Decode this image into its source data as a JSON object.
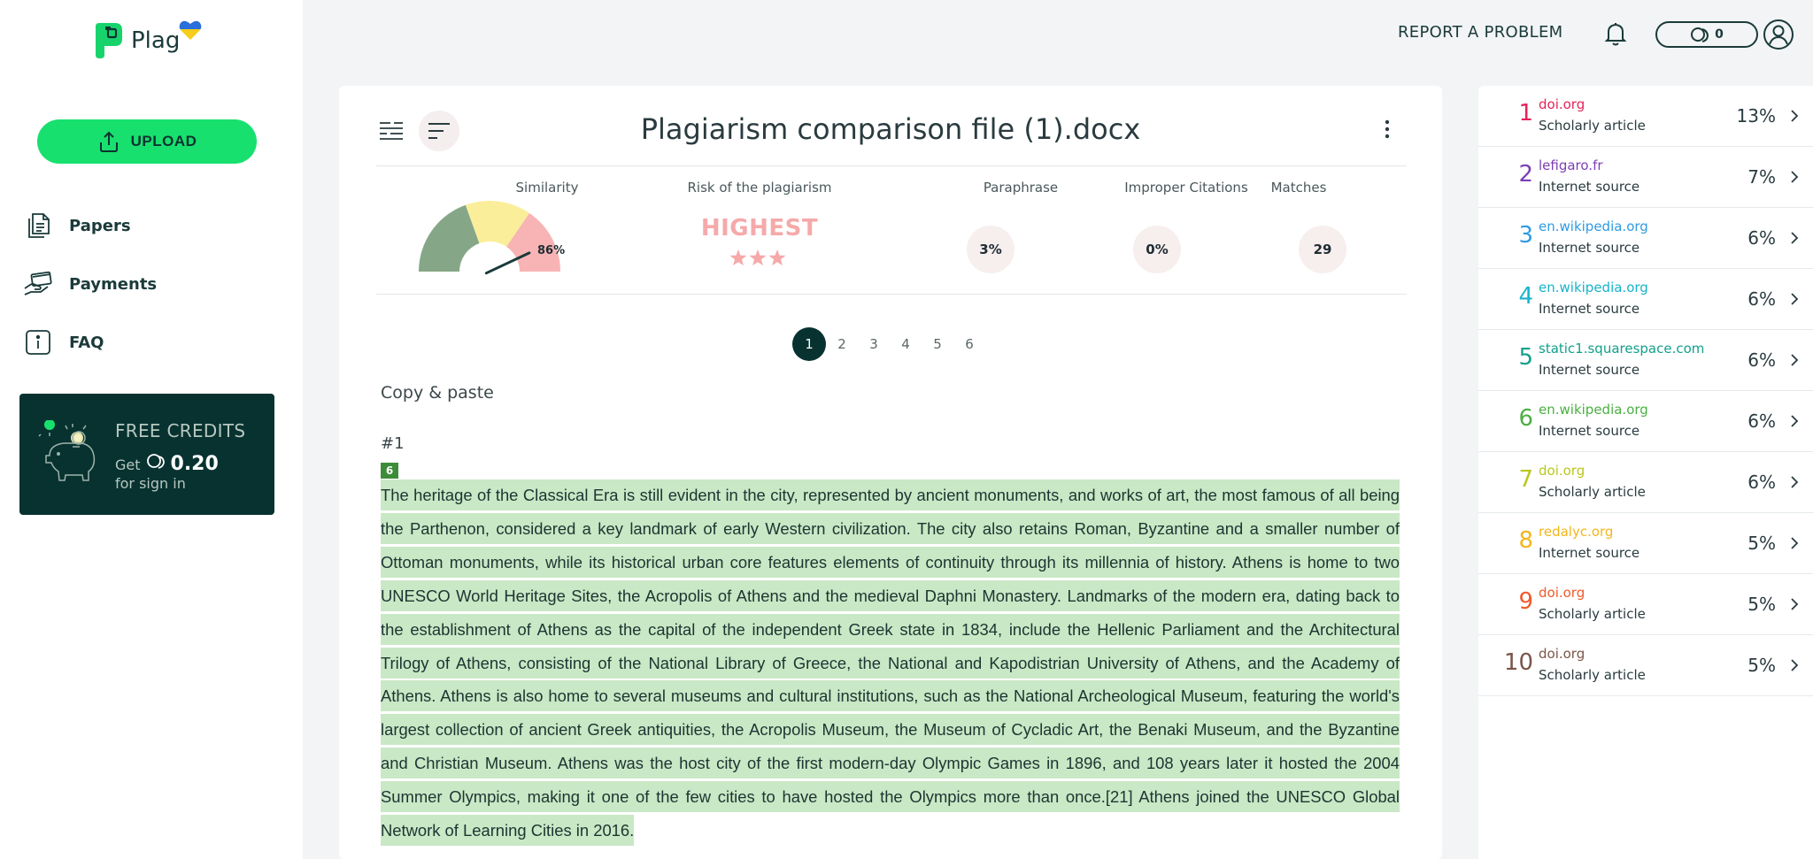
{
  "brand": {
    "name": "Plag",
    "logo_colors": {
      "green": "#18d36c",
      "heart_blue": "#2a6fdb",
      "heart_yellow": "#f6cd1a"
    }
  },
  "sidebar": {
    "upload_label": "UPLOAD",
    "nav": [
      {
        "label": "Papers",
        "icon": "document-icon"
      },
      {
        "label": "Payments",
        "icon": "hand-card-icon"
      },
      {
        "label": "FAQ",
        "icon": "info-icon"
      }
    ],
    "credits": {
      "title": "FREE CREDITS",
      "get": "Get",
      "amount": "0.20",
      "subtitle": "for sign in"
    }
  },
  "topbar": {
    "report": "REPORT A PROBLEM",
    "credit_count": "0"
  },
  "document": {
    "title": "Plagiarism comparison file (1).docx",
    "metrics": {
      "similarity_label": "Similarity",
      "similarity_value": "86%",
      "similarity_fraction": 0.86,
      "risk_label": "Risk of the plagiarism",
      "risk_value": "HIGHEST",
      "risk_stars": 3,
      "paraphrase_label": "Paraphrase",
      "paraphrase_value": "3%",
      "citations_label": "Improper Citations",
      "citations_value": "0%",
      "matches_label": "Matches",
      "matches_value": "29"
    },
    "pages": [
      "1",
      "2",
      "3",
      "4",
      "5",
      "6"
    ],
    "active_page": "1",
    "section_label": "Copy & paste",
    "paragraph_number": "#1",
    "match_badge": "6",
    "passage": "The heritage of the Classical Era is still evident in the city, represented by ancient monuments, and works of art, the most famous of all being the Parthenon, considered a key landmark of early Western civilization. The city also retains Roman, Byzantine and a smaller number of Ottoman monuments, while its historical urban core features elements of continuity through its millennia of history. Athens is home to two UNESCO World Heritage Sites, the Acropolis of Athens and the medieval Daphni Monastery. Landmarks of the modern era, dating back to the establishment of Athens as the capital of the independent Greek state in 1834, include the Hellenic Parliament and the Architectural Trilogy of Athens, consisting of the National Library of Greece, the National and Kapodistrian University of Athens, and the Academy of Athens. Athens is also home to several museums and cultural institutions, such as the National Archeological Museum, featuring the world's largest collection of ancient Greek antiquities, the Acropolis Museum, the Museum of Cycladic Art, the Benaki Museum, and the Byzantine and Christian Museum. Athens was the host city of the first modern-day Olympic Games in 1896, and 108 years later it hosted the 2004 Summer Olympics, making it one of the few cities to have hosted the Olympics more than once.[21] Athens joined the UNESCO Global Network of Learning Cities in 2016."
  },
  "sources": [
    {
      "rank": "1",
      "domain": "doi.org",
      "kind": "Scholarly article",
      "percent": "13%",
      "color": "#e3245a"
    },
    {
      "rank": "2",
      "domain": "lefigaro.fr",
      "kind": "Internet source",
      "percent": "7%",
      "color": "#7b3fb5"
    },
    {
      "rank": "3",
      "domain": "en.wikipedia.org",
      "kind": "Internet source",
      "percent": "6%",
      "color": "#2f9be0"
    },
    {
      "rank": "4",
      "domain": "en.wikipedia.org",
      "kind": "Internet source",
      "percent": "6%",
      "color": "#17b3c9"
    },
    {
      "rank": "5",
      "domain": "static1.squarespace.com",
      "kind": "Internet source",
      "percent": "6%",
      "color": "#12a08c"
    },
    {
      "rank": "6",
      "domain": "en.wikipedia.org",
      "kind": "Internet source",
      "percent": "6%",
      "color": "#4caf43"
    },
    {
      "rank": "7",
      "domain": "doi.org",
      "kind": "Scholarly article",
      "percent": "6%",
      "color": "#b9c71c"
    },
    {
      "rank": "8",
      "domain": "redalyc.org",
      "kind": "Internet source",
      "percent": "5%",
      "color": "#f2b61c"
    },
    {
      "rank": "9",
      "domain": "doi.org",
      "kind": "Scholarly article",
      "percent": "5%",
      "color": "#ef5a2a"
    },
    {
      "rank": "10",
      "domain": "doi.org",
      "kind": "Scholarly article",
      "percent": "5%",
      "color": "#7a5547"
    }
  ],
  "colors": {
    "accent": "#18e06e",
    "dark": "#073230",
    "highlight": "#c9e8c5",
    "risk": "#f6a9a9"
  }
}
